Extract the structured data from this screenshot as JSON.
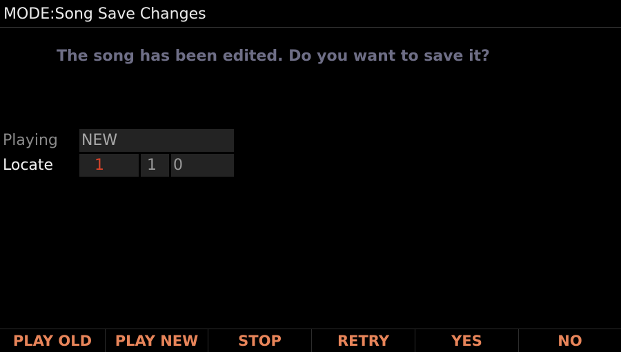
{
  "header": {
    "title": "MODE:Song Save Changes"
  },
  "dialog": {
    "prompt": "The song has been edited. Do you want to save it?"
  },
  "playing": {
    "label": "Playing",
    "value": "NEW"
  },
  "locate": {
    "label": "Locate",
    "bar": "1",
    "beat": "1",
    "tick": "0"
  },
  "softkeys": [
    {
      "label": "PLAY OLD"
    },
    {
      "label": "PLAY NEW"
    },
    {
      "label": "STOP"
    },
    {
      "label": "RETRY"
    },
    {
      "label": "YES"
    },
    {
      "label": "NO"
    }
  ],
  "colors": {
    "background": "#000000",
    "softkey_text": "#e8855a",
    "prompt_text": "#6e6e86",
    "locate_bar_text": "#d8432a",
    "field_background": "#232323"
  }
}
